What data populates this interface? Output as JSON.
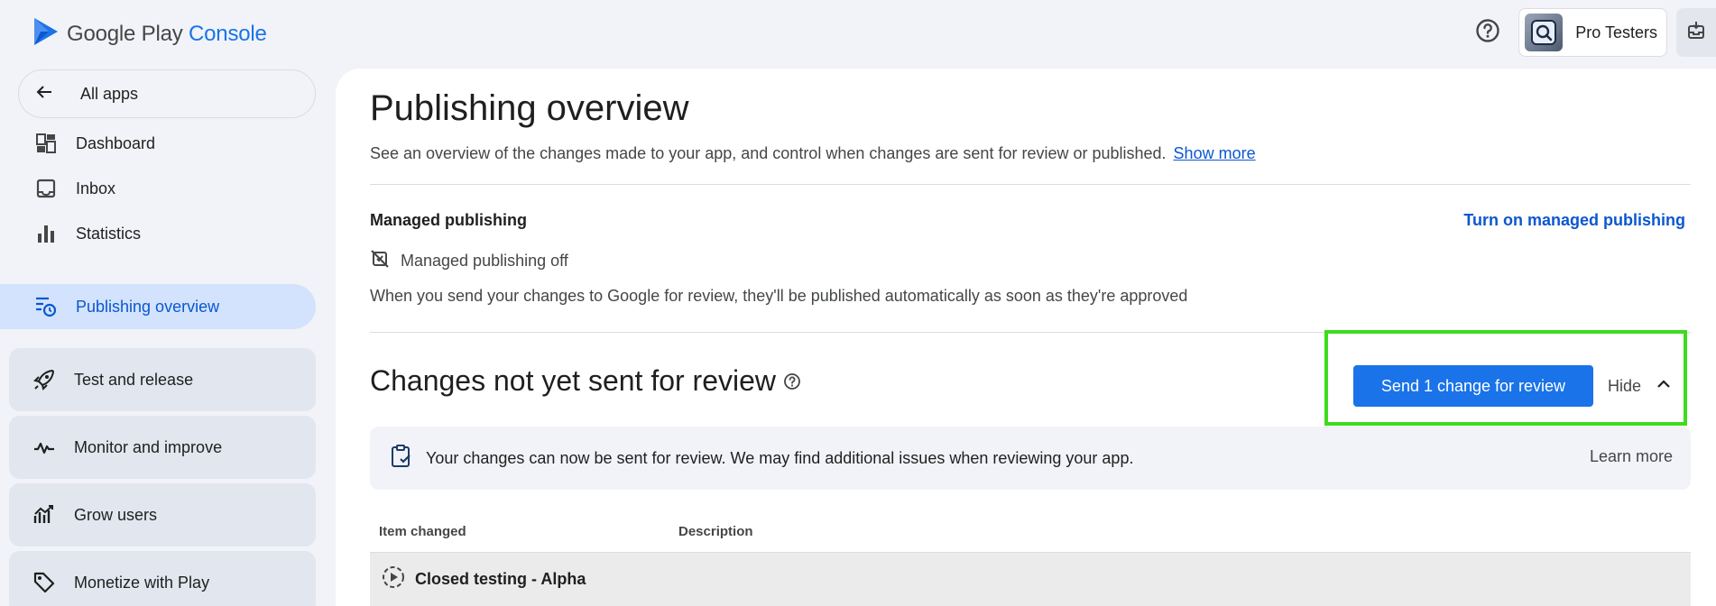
{
  "header": {
    "logo_main": "Google Play",
    "logo_accent": "Console",
    "account_name": "Pro Testers",
    "help_icon": "help-circle-icon",
    "notifications_icon": "inbox-notification-icon"
  },
  "sidebar": {
    "all_apps_label": "All apps",
    "items": [
      {
        "label": "Dashboard",
        "icon": "dashboard-icon"
      },
      {
        "label": "Inbox",
        "icon": "inbox-icon"
      },
      {
        "label": "Statistics",
        "icon": "bar-chart-icon"
      },
      {
        "label": "Publishing overview",
        "icon": "publishing-icon",
        "active": true
      }
    ],
    "groups": [
      {
        "label": "Test and release",
        "icon": "rocket-icon"
      },
      {
        "label": "Monitor and improve",
        "icon": "vitals-icon"
      },
      {
        "label": "Grow users",
        "icon": "growth-icon"
      },
      {
        "label": "Monetize with Play",
        "icon": "tag-icon"
      }
    ]
  },
  "main": {
    "title": "Publishing overview",
    "description": "See an overview of the changes made to your app, and control when changes are sent for review or published.",
    "show_more": "Show more",
    "managed_publishing": {
      "title": "Managed publishing",
      "turn_on_link": "Turn on managed publishing",
      "status": "Managed publishing off",
      "description": "When you send your changes to Google for review, they'll be published automatically as soon as they're approved"
    },
    "changes": {
      "title": "Changes not yet sent for review",
      "send_button": "Send 1 change for review",
      "hide_label": "Hide",
      "info_text": "Your changes can now be sent for review. We may find additional issues when reviewing your app.",
      "learn_more": "Learn more",
      "columns": [
        "Item changed",
        "Description"
      ],
      "rows": [
        {
          "item": "Closed testing - Alpha",
          "description": ""
        }
      ]
    }
  },
  "colors": {
    "accent": "#1a73e8",
    "active_nav_bg": "#d3e3fd",
    "highlight": "#3ddc1d"
  }
}
